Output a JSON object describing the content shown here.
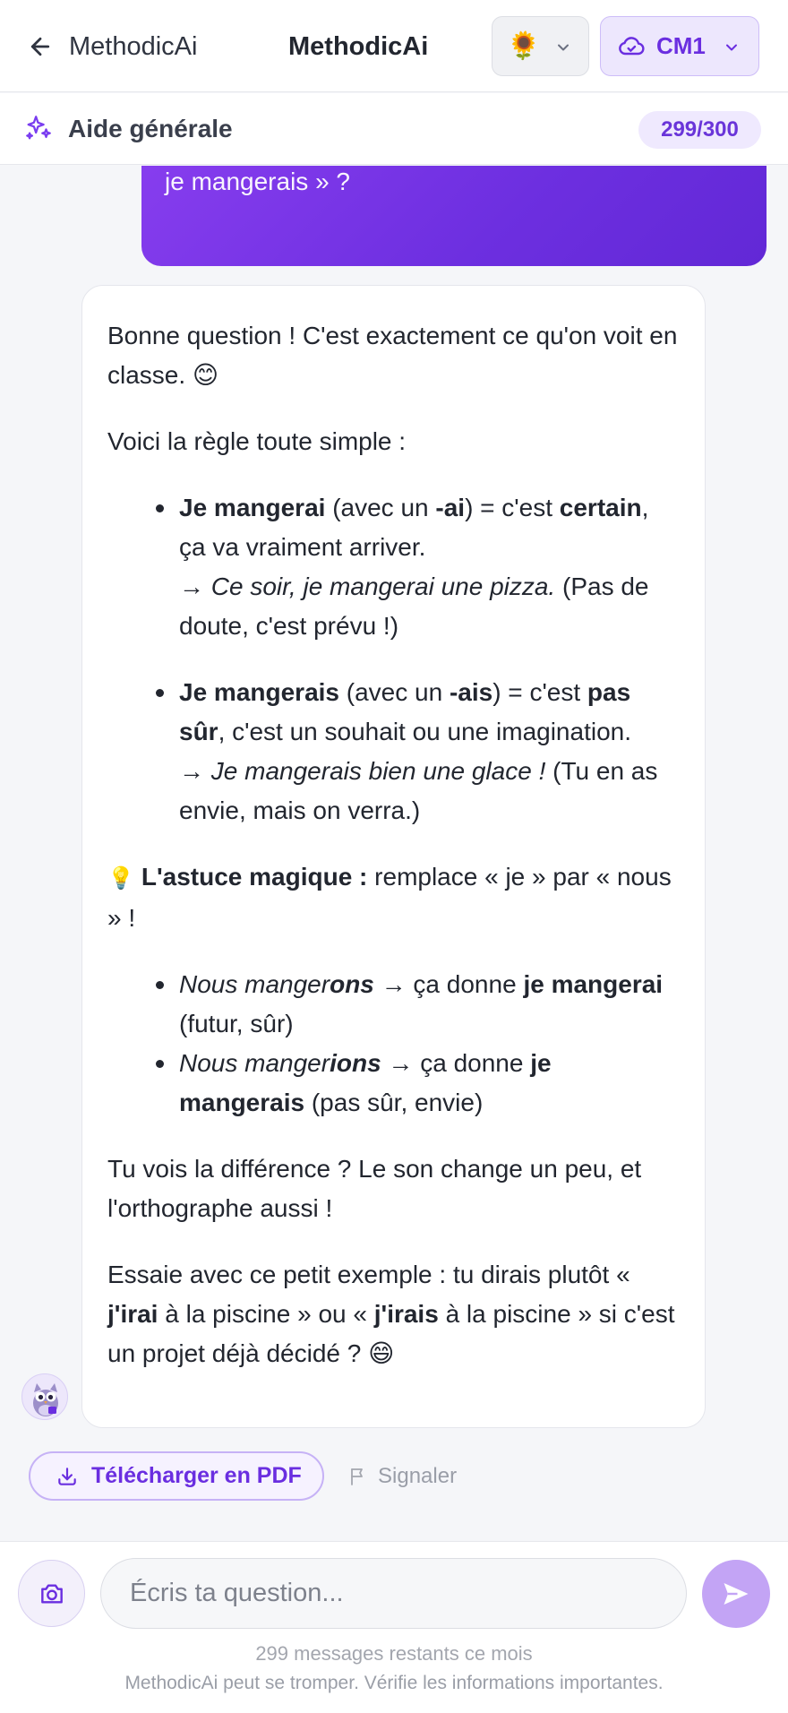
{
  "header": {
    "back_label": "MethodicAi",
    "title": "MethodicAi",
    "mood_emoji": "🌻",
    "class_label": "CM1"
  },
  "subheader": {
    "mode": "Aide générale",
    "quota": "299/300"
  },
  "user_message": {
    "visible_text": "je mangerais » ?"
  },
  "ai_message": {
    "intro_a": "Bonne question ! C'est exactement ce qu'on voit en classe. 😊",
    "intro_b": "Voici la règle toute simple :",
    "rule1": {
      "term": "Je mangerai",
      "pre": " (avec un ",
      "ending": "-ai",
      "mid": ") = c'est ",
      "key": "certain",
      "rest": ", ça va vraiment arriver.",
      "arrow": "→ ",
      "example": "Ce soir, je mangerai une pizza.",
      "note": " (Pas de doute, c'est prévu !)"
    },
    "rule2": {
      "term": "Je mangerais",
      "pre": " (avec un ",
      "ending": "-ais",
      "mid": ") = c'est ",
      "key": "pas sûr",
      "rest": ", c'est un souhait ou une imagination.",
      "arrow": "→ ",
      "example": "Je mangerais bien une glace !",
      "note": " (Tu en as envie, mais on verra.)"
    },
    "tip": {
      "icon": "💡",
      "title": "L'astuce magique :",
      "text": " remplace « je » par « nous » !"
    },
    "tip_item1": {
      "stem": "Nous manger",
      "suffix": "ons",
      "arrow": " → ça donne ",
      "result": "je mangerai",
      "note": " (futur, sûr)"
    },
    "tip_item2": {
      "stem": "Nous manger",
      "suffix": "ions",
      "arrow": " → ça donne ",
      "result": "je mangerais",
      "note": " (pas sûr, envie)"
    },
    "diff": "Tu vois la différence ? Le son change un peu, et l'orthographe aussi !",
    "exercise": {
      "a": "Essaie avec ce petit exemple : tu dirais plutôt « ",
      "b": "j'irai",
      "c": " à la piscine » ou « ",
      "d": "j'irais",
      "e": " à la piscine » si c'est un projet déjà décidé ? 😄"
    }
  },
  "actions": {
    "pdf": "Télécharger en PDF",
    "report": "Signaler"
  },
  "composer": {
    "placeholder": "Écris ta question...",
    "remaining": "299 messages restants ce mois",
    "disclaimer": "MethodicAi peut se tromper. Vérifie les informations importantes."
  },
  "colors": {
    "accent": "#6a2ee0",
    "bubble_gradient_start": "#8a3ff0",
    "bubble_gradient_end": "#6228d6",
    "send": "#c3a4f5"
  }
}
